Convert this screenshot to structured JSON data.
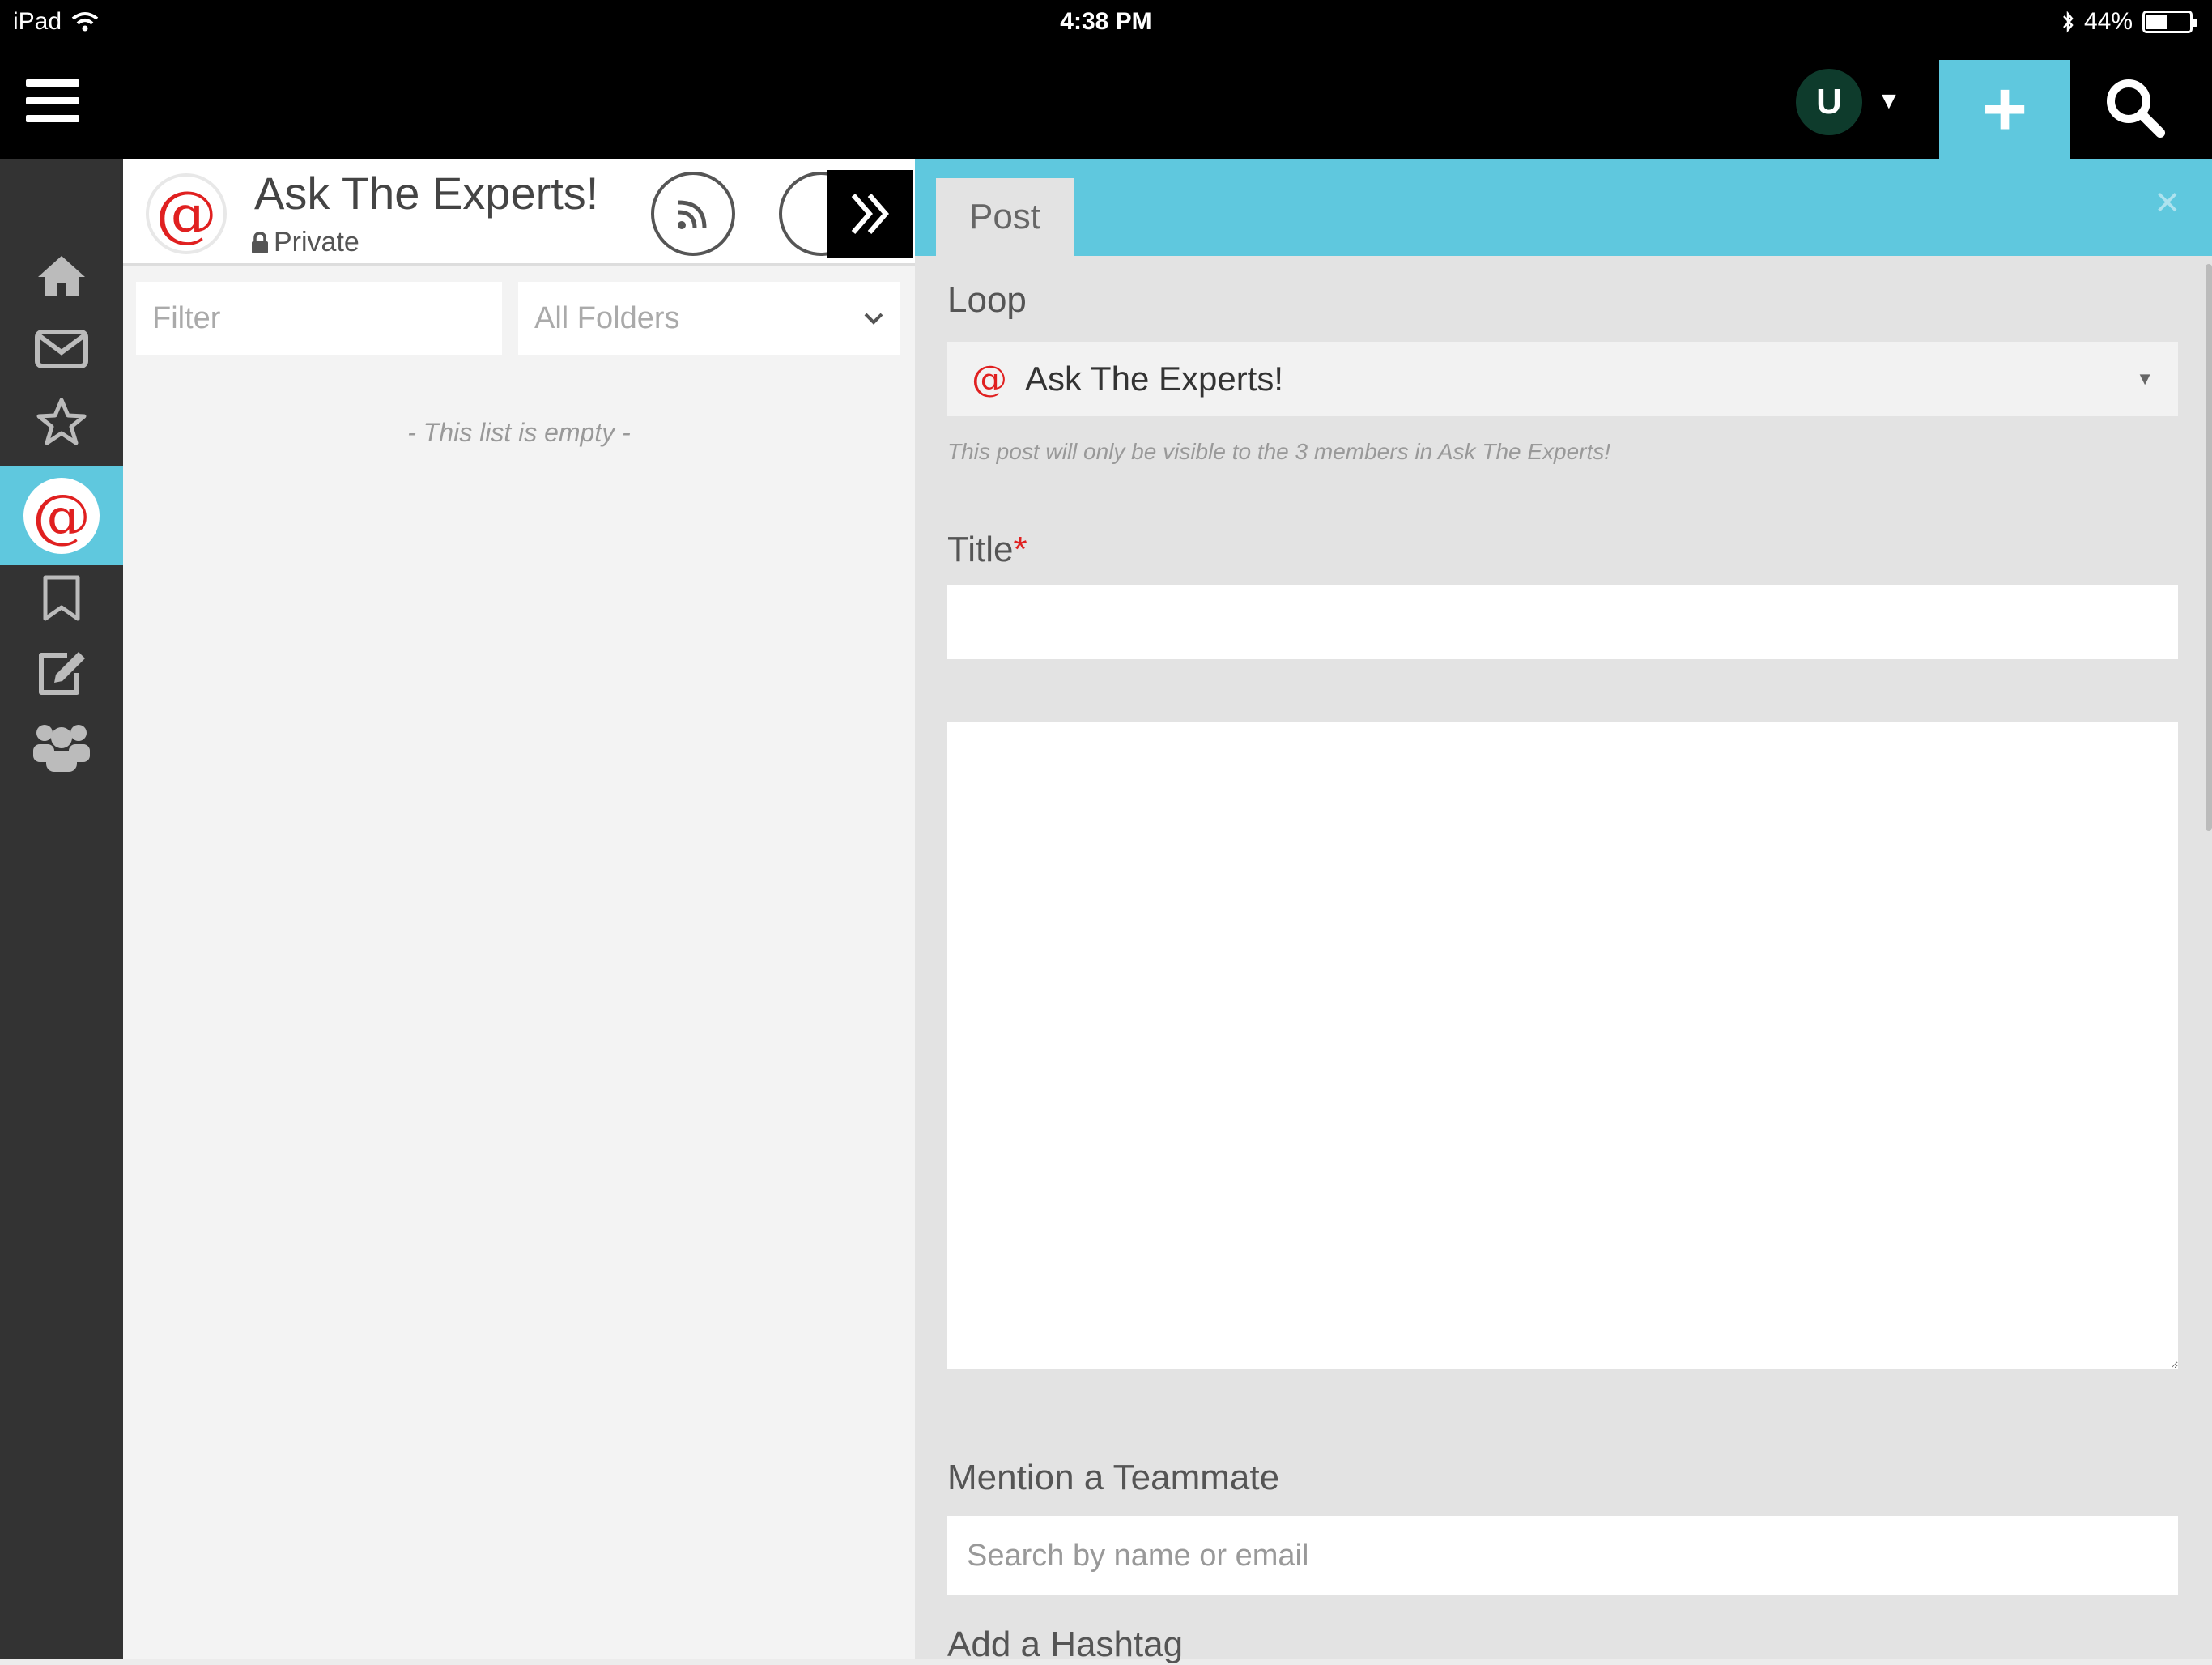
{
  "status_bar": {
    "device": "iPad",
    "time": "4:38 PM",
    "battery": "44%"
  },
  "top_bar": {
    "avatar_initial": "U",
    "add_label": "+"
  },
  "loop": {
    "title": "Ask The Experts!",
    "privacy": "Private",
    "icon": "@"
  },
  "list": {
    "filter_placeholder": "Filter",
    "folder_selected": "All Folders",
    "empty_message": "- This list is empty -"
  },
  "post_form": {
    "tab_label": "Post",
    "close_label": "×",
    "loop_label": "Loop",
    "loop_value": "Ask The Experts!",
    "visibility_note": "This post will only be visible to the 3 members in Ask The Experts!",
    "title_label": "Title",
    "required_mark": "*",
    "mention_label": "Mention a Teammate",
    "mention_placeholder": "Search by name or email",
    "hashtag_label": "Add a Hashtag"
  },
  "sidebar": {
    "items": [
      "home",
      "mail",
      "favorites",
      "mentions",
      "bookmarks",
      "compose",
      "teams"
    ]
  },
  "colors": {
    "accent": "#5fc8de",
    "at_red": "#e02020",
    "sidebar_bg": "#333333",
    "avatar_bg": "#0e3b2c"
  }
}
